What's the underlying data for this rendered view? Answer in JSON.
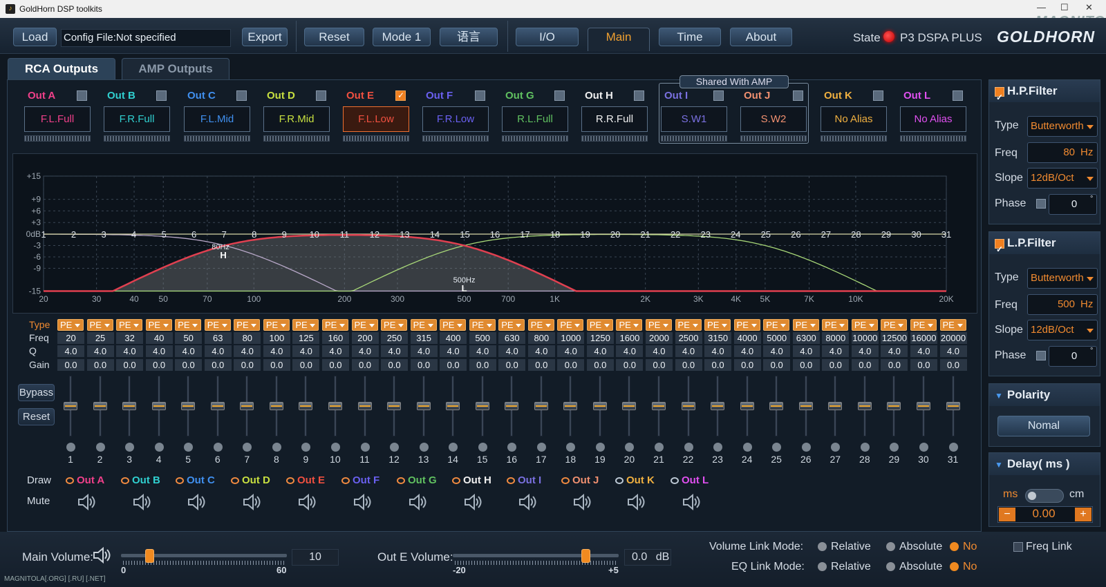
{
  "window": {
    "title": "GoldHorn DSP toolkits",
    "watermark": "MAGNITOLA",
    "icon": "goldhorn-app-icon"
  },
  "toolbar": {
    "load": "Load",
    "config": "Config File:Not specified",
    "export": "Export",
    "reset": "Reset",
    "mode": "Mode 1",
    "language": "语言",
    "nav": [
      {
        "label": "I/O",
        "active": false
      },
      {
        "label": "Main",
        "active": true
      },
      {
        "label": "Time",
        "active": false
      },
      {
        "label": "About",
        "active": false
      }
    ],
    "state_label": "State",
    "device": "P3 DSPA PLUS",
    "logo": "GOLDHORN"
  },
  "tabs": [
    {
      "label": "RCA Outputs",
      "active": true
    },
    {
      "label": "AMP Outputs",
      "active": false
    }
  ],
  "outputs": [
    {
      "name": "Out A",
      "alias": "F.L.Full",
      "color": "#f0408a",
      "checked": false
    },
    {
      "name": "Out B",
      "alias": "F.R.Full",
      "color": "#30d0d0",
      "checked": false
    },
    {
      "name": "Out C",
      "alias": "F.L.Mid",
      "color": "#4090f0",
      "checked": false
    },
    {
      "name": "Out D",
      "alias": "F.R.Mid",
      "color": "#c8e040",
      "checked": false
    },
    {
      "name": "Out E",
      "alias": "F.L.Low",
      "color": "#f05040",
      "checked": true
    },
    {
      "name": "Out F",
      "alias": "F.R.Low",
      "color": "#6a60f0",
      "checked": false
    },
    {
      "name": "Out G",
      "alias": "R.L.Full",
      "color": "#60c060",
      "checked": false
    },
    {
      "name": "Out H",
      "alias": "R.R.Full",
      "color": "#f0f0f0",
      "checked": false
    },
    {
      "name": "Out I",
      "alias": "S.W1",
      "color": "#7a70e0",
      "checked": false
    },
    {
      "name": "Out J",
      "alias": "S.W2",
      "color": "#f09070",
      "checked": false
    },
    {
      "name": "Out K",
      "alias": "No Alias",
      "color": "#f0b040",
      "checked": false
    },
    {
      "name": "Out L",
      "alias": "No Alias",
      "color": "#e050f0",
      "checked": false
    }
  ],
  "shared_label": "Shared With AMP",
  "eq_graph": {
    "y_ticks": [
      "+15",
      "+9",
      "+6",
      "+3",
      "0dB",
      "-3",
      "-6",
      "-9",
      "-15"
    ],
    "x_ticks": [
      "20",
      "30",
      "40",
      "50",
      "70",
      "100",
      "200",
      "300",
      "500",
      "700",
      "1K",
      "2K",
      "3K",
      "4K",
      "5K",
      "7K",
      "10K",
      "20K"
    ],
    "band_markers": [
      "1",
      "2",
      "3",
      "4",
      "5",
      "6",
      "7",
      "8",
      "9",
      "10",
      "11",
      "12",
      "13",
      "14",
      "15",
      "16",
      "17",
      "18",
      "19",
      "20",
      "21",
      "22",
      "23",
      "24",
      "25",
      "26",
      "27",
      "28",
      "29",
      "30",
      "31"
    ],
    "hp_marker": {
      "freq_label": "80Hz",
      "letter": "H"
    },
    "lp_marker": {
      "freq_label": "500Hz",
      "letter": "L"
    }
  },
  "eq_table": {
    "row_labels": {
      "type": "Type",
      "freq": "Freq",
      "q": "Q",
      "gain": "Gain"
    },
    "type": "PE",
    "freqs": [
      "20",
      "25",
      "32",
      "40",
      "50",
      "63",
      "80",
      "100",
      "125",
      "160",
      "200",
      "250",
      "315",
      "400",
      "500",
      "630",
      "800",
      "1000",
      "1250",
      "1600",
      "2000",
      "2500",
      "3150",
      "4000",
      "5000",
      "6300",
      "8000",
      "10000",
      "12500",
      "16000",
      "20000"
    ],
    "q": "4.0",
    "gain": "0.0",
    "fader_gain_db": 0
  },
  "side_buttons": {
    "bypass": "Bypass",
    "reset": "Reset"
  },
  "draw_label": "Draw",
  "mute_label": "Mute",
  "draw_items": [
    "Out A",
    "Out B",
    "Out C",
    "Out D",
    "Out E",
    "Out F",
    "Out G",
    "Out H",
    "Out I",
    "Out J",
    "Out K",
    "Out L"
  ],
  "hp_filter": {
    "title": "H.P.Filter",
    "enabled": true,
    "type_label": "Type",
    "type": "Butterworth",
    "freq_label": "Freq",
    "freq": "80",
    "unit": "Hz",
    "slope_label": "Slope",
    "slope": "12dB/Oct",
    "phase_label": "Phase",
    "phase": "0",
    "deg": "°"
  },
  "lp_filter": {
    "title": "L.P.Filter",
    "enabled": true,
    "type_label": "Type",
    "type": "Butterworth",
    "freq_label": "Freq",
    "freq": "500",
    "unit": "Hz",
    "slope_label": "Slope",
    "slope": "12dB/Oct",
    "phase_label": "Phase",
    "phase": "0",
    "deg": "°"
  },
  "polarity": {
    "title": "Polarity",
    "value": "Nomal"
  },
  "delay": {
    "title": "Delay( ms )",
    "ms": "ms",
    "cm": "cm",
    "value": "0.00",
    "minus": "−",
    "plus": "+"
  },
  "bottom": {
    "main_volume_label": "Main Volume:",
    "main_volume_value": "10",
    "main_min": "0",
    "main_max": "60",
    "main_fraction": 0.17,
    "out_volume_label": "Out E Volume:",
    "out_volume_value": "0.0",
    "out_unit": "dB",
    "out_min": "-20",
    "out_max": "+5",
    "out_fraction": 0.8,
    "volume_link_label": "Volume Link Mode:",
    "eq_link_label": "EQ Link Mode:",
    "relative": "Relative",
    "absolute": "Absolute",
    "no": "No",
    "link_selected": "No",
    "freq_link": "Freq Link",
    "freq_link_checked": false
  },
  "footer": "MAGNITOLA[.ORG] [.RU] [.NET]",
  "colors": {
    "accent": "#f08a30",
    "panel": "#121c27",
    "curve": "#e04050"
  }
}
